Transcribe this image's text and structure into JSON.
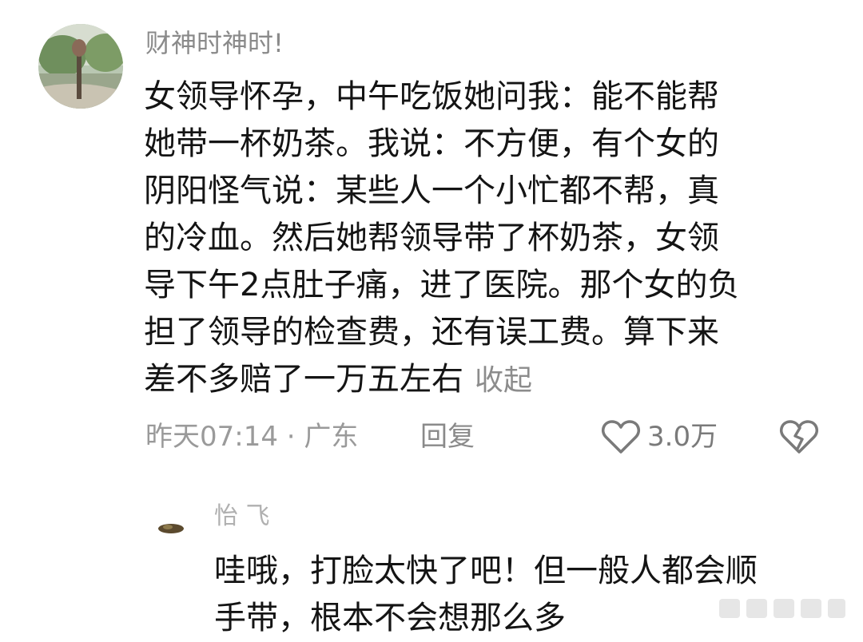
{
  "comment": {
    "username": "财神时神时!",
    "text_lines": [
      "女领导怀孕，中午吃饭她问我：能不能帮",
      "她带一杯奶茶。我说：不方便，有个女的",
      "阴阳怪气说：某些人一个小忙都不帮，真",
      "的冷血。然后她帮领导带了杯奶茶，女领",
      "导下午2点肚子痛，进了医院。那个女的负",
      "担了领导的检查费，还有误工费。算下来",
      "差不多赔了一万五左右"
    ],
    "collapse_label": "收起",
    "timestamp": "昨天07:14 · 广东",
    "reply_label": "回复",
    "like_count": "3.0万"
  },
  "reply": {
    "username": "怡  飞",
    "text_lines": [
      "哇哦，打脸太快了吧！但一般人都会顺",
      "手带，根本不会想那么多"
    ]
  },
  "colors": {
    "text": "#141414",
    "meta": "#9a9a9a",
    "icon": "#7a7a7a",
    "background": "#ffffff"
  },
  "icons": {
    "like": "heart-outline-icon",
    "dislike": "broken-heart-icon"
  }
}
